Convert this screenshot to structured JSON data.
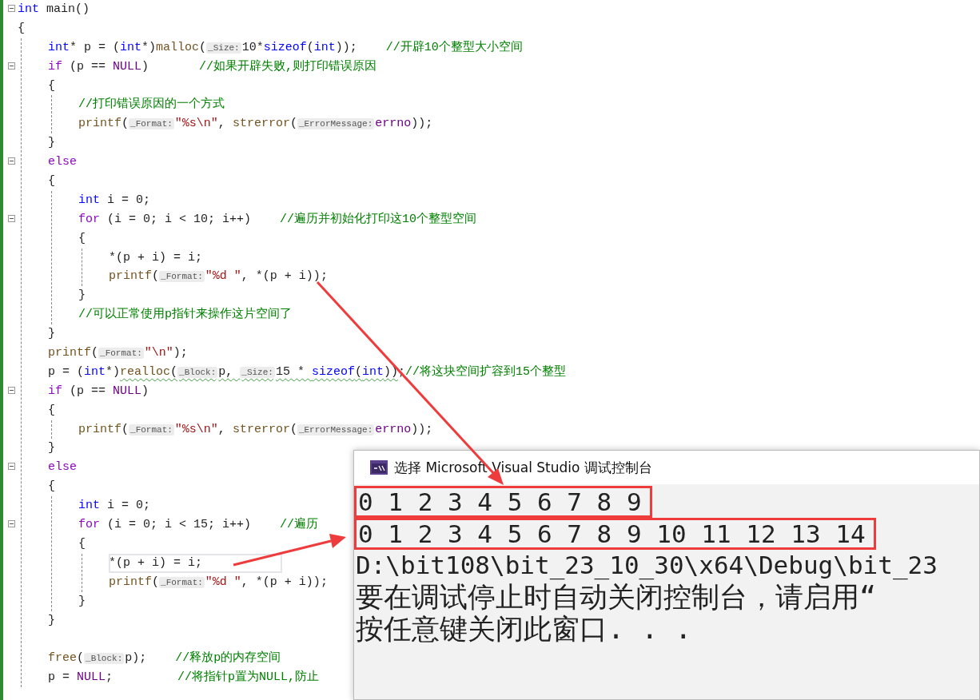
{
  "editor": {
    "lines": [
      {
        "expanded": true,
        "tokens": [
          {
            "kind": "type",
            "text": "int"
          },
          {
            "kind": "plain",
            "text": " main()"
          }
        ]
      },
      {
        "tokens": [
          {
            "kind": "plain",
            "text": "{"
          }
        ],
        "children": [
          {
            "tokens": [
              {
                "kind": "type",
                "text": "int"
              },
              {
                "kind": "plain",
                "text": "* p = ("
              },
              {
                "kind": "type",
                "text": "int"
              },
              {
                "kind": "plain",
                "text": "*)"
              },
              {
                "kind": "func",
                "text": "malloc"
              },
              {
                "kind": "plain",
                "text": "("
              },
              {
                "kind": "hint",
                "text": "_Size:"
              },
              {
                "kind": "plain",
                "text": "10*"
              },
              {
                "kind": "type",
                "text": "sizeof"
              },
              {
                "kind": "plain",
                "text": "("
              },
              {
                "kind": "type",
                "text": "int"
              },
              {
                "kind": "plain",
                "text": "));    "
              },
              {
                "kind": "comment",
                "text": "//开辟10个整型大小空间"
              }
            ]
          },
          {
            "expanded": true,
            "tokens": [
              {
                "kind": "control",
                "text": "if"
              },
              {
                "kind": "plain",
                "text": " (p == "
              },
              {
                "kind": "macro",
                "text": "NULL"
              },
              {
                "kind": "plain",
                "text": ")       "
              },
              {
                "kind": "comment",
                "text": "//如果开辟失败,则打印错误原因"
              }
            ]
          },
          {
            "tokens": [
              {
                "kind": "plain",
                "text": "{"
              }
            ],
            "children": [
              {
                "tokens": [
                  {
                    "kind": "comment",
                    "text": "//打印错误原因的一个方式"
                  }
                ]
              },
              {
                "tokens": [
                  {
                    "kind": "func",
                    "text": "printf"
                  },
                  {
                    "kind": "plain",
                    "text": "("
                  },
                  {
                    "kind": "hint",
                    "text": "_Format:"
                  },
                  {
                    "kind": "string",
                    "text": "\"%s\\n\""
                  },
                  {
                    "kind": "plain",
                    "text": ", "
                  },
                  {
                    "kind": "func",
                    "text": "strerror"
                  },
                  {
                    "kind": "plain",
                    "text": "("
                  },
                  {
                    "kind": "hint",
                    "text": "_ErrorMessage:"
                  },
                  {
                    "kind": "macro",
                    "text": "errno"
                  },
                  {
                    "kind": "plain",
                    "text": "));"
                  }
                ]
              }
            ]
          },
          {
            "tokens": [
              {
                "kind": "plain",
                "text": "}"
              }
            ]
          },
          {
            "expanded": true,
            "tokens": [
              {
                "kind": "control",
                "text": "else"
              }
            ]
          },
          {
            "tokens": [
              {
                "kind": "plain",
                "text": "{"
              }
            ],
            "children": [
              {
                "tokens": [
                  {
                    "kind": "type",
                    "text": "int"
                  },
                  {
                    "kind": "plain",
                    "text": " i = 0;"
                  }
                ]
              },
              {
                "expanded": true,
                "tokens": [
                  {
                    "kind": "control",
                    "text": "for"
                  },
                  {
                    "kind": "plain",
                    "text": " (i = 0; i < 10; i++)    "
                  },
                  {
                    "kind": "comment",
                    "text": "//遍历并初始化打印这10个整型空间"
                  }
                ]
              },
              {
                "tokens": [
                  {
                    "kind": "plain",
                    "text": "{"
                  }
                ],
                "children": [
                  {
                    "tokens": [
                      {
                        "kind": "plain",
                        "text": "*(p + i) = i;"
                      }
                    ]
                  },
                  {
                    "tokens": [
                      {
                        "kind": "func",
                        "text": "printf"
                      },
                      {
                        "kind": "plain",
                        "text": "("
                      },
                      {
                        "kind": "hint",
                        "text": "_Format:"
                      },
                      {
                        "kind": "string",
                        "text": "\"%d \""
                      },
                      {
                        "kind": "plain",
                        "text": ", *(p + i));"
                      }
                    ]
                  }
                ]
              },
              {
                "tokens": [
                  {
                    "kind": "plain",
                    "text": "}"
                  }
                ]
              },
              {
                "tokens": [
                  {
                    "kind": "comment",
                    "text": "//可以正常使用p指针来操作这片空间了"
                  }
                ]
              }
            ]
          },
          {
            "tokens": [
              {
                "kind": "plain",
                "text": "}"
              }
            ]
          },
          {
            "tokens": [
              {
                "kind": "func",
                "text": "printf"
              },
              {
                "kind": "plain",
                "text": "("
              },
              {
                "kind": "hint",
                "text": "_Format:"
              },
              {
                "kind": "string",
                "text": "\"\\n\""
              },
              {
                "kind": "plain",
                "text": ");"
              }
            ]
          },
          {
            "tokens": [
              {
                "kind": "plain",
                "text": "p = ("
              },
              {
                "kind": "type",
                "text": "int"
              },
              {
                "kind": "plain",
                "text": "*)"
              },
              {
                "kind": "group",
                "squiggle": true,
                "tokens": [
                  {
                    "kind": "func",
                    "text": "realloc"
                  },
                  {
                    "kind": "plain",
                    "text": "("
                  },
                  {
                    "kind": "hint",
                    "text": "_Block:"
                  },
                  {
                    "kind": "plain",
                    "text": "p, "
                  },
                  {
                    "kind": "hint",
                    "text": "_Size:"
                  },
                  {
                    "kind": "plain",
                    "text": "15 * "
                  },
                  {
                    "kind": "type",
                    "text": "sizeof"
                  },
                  {
                    "kind": "plain",
                    "text": "("
                  },
                  {
                    "kind": "type",
                    "text": "int"
                  },
                  {
                    "kind": "plain",
                    "text": "))"
                  }
                ]
              },
              {
                "kind": "plain",
                "text": ";"
              },
              {
                "kind": "comment",
                "text": "//将这块空间扩容到15个整型"
              }
            ]
          },
          {
            "expanded": true,
            "tokens": [
              {
                "kind": "control",
                "text": "if"
              },
              {
                "kind": "plain",
                "text": " (p == "
              },
              {
                "kind": "macro",
                "text": "NULL"
              },
              {
                "kind": "plain",
                "text": ")"
              }
            ]
          },
          {
            "tokens": [
              {
                "kind": "plain",
                "text": "{"
              }
            ],
            "children": [
              {
                "tokens": [
                  {
                    "kind": "func",
                    "text": "printf"
                  },
                  {
                    "kind": "plain",
                    "text": "("
                  },
                  {
                    "kind": "hint",
                    "text": "_Format:"
                  },
                  {
                    "kind": "string",
                    "text": "\"%s\\n\""
                  },
                  {
                    "kind": "plain",
                    "text": ", "
                  },
                  {
                    "kind": "func",
                    "text": "strerror"
                  },
                  {
                    "kind": "plain",
                    "text": "("
                  },
                  {
                    "kind": "hint",
                    "text": "_ErrorMessage:"
                  },
                  {
                    "kind": "macro",
                    "text": "errno"
                  },
                  {
                    "kind": "plain",
                    "text": "));"
                  }
                ]
              }
            ]
          },
          {
            "tokens": [
              {
                "kind": "plain",
                "text": "}"
              }
            ]
          },
          {
            "expanded": true,
            "tokens": [
              {
                "kind": "control",
                "text": "else"
              }
            ]
          },
          {
            "tokens": [
              {
                "kind": "plain",
                "text": "{"
              }
            ],
            "children": [
              {
                "tokens": [
                  {
                    "kind": "type",
                    "text": "int"
                  },
                  {
                    "kind": "plain",
                    "text": " i = 0;"
                  }
                ]
              },
              {
                "expanded": true,
                "tokens": [
                  {
                    "kind": "control",
                    "text": "for"
                  },
                  {
                    "kind": "plain",
                    "text": " (i = 0; i < 15; i++)    "
                  },
                  {
                    "kind": "comment",
                    "text": "//遍历"
                  }
                ]
              },
              {
                "tokens": [
                  {
                    "kind": "plain",
                    "text": "{"
                  }
                ],
                "children": [
                  {
                    "current": true,
                    "tokens": [
                      {
                        "kind": "plain",
                        "text": "*(p + i) = i;"
                      }
                    ]
                  },
                  {
                    "tokens": [
                      {
                        "kind": "func",
                        "text": "printf"
                      },
                      {
                        "kind": "plain",
                        "text": "("
                      },
                      {
                        "kind": "hint",
                        "text": "_Format:"
                      },
                      {
                        "kind": "string",
                        "text": "\"%d \""
                      },
                      {
                        "kind": "plain",
                        "text": ", *(p + i));"
                      }
                    ]
                  }
                ]
              },
              {
                "tokens": [
                  {
                    "kind": "plain",
                    "text": "}"
                  }
                ]
              }
            ]
          },
          {
            "tokens": [
              {
                "kind": "plain",
                "text": "}"
              }
            ]
          },
          {
            "gap_before": true,
            "tokens": [
              {
                "kind": "func",
                "text": "free"
              },
              {
                "kind": "plain",
                "text": "("
              },
              {
                "kind": "hint",
                "text": "_Block:"
              },
              {
                "kind": "plain",
                "text": "p);    "
              },
              {
                "kind": "comment",
                "text": "//释放p的内存空间"
              }
            ]
          },
          {
            "tokens": [
              {
                "kind": "plain",
                "text": "p = "
              },
              {
                "kind": "macro",
                "text": "NULL"
              },
              {
                "kind": "plain",
                "text": ";         "
              },
              {
                "kind": "comment",
                "text": "//将指针p置为NULL,防止"
              }
            ]
          }
        ]
      }
    ]
  },
  "console": {
    "title": "选择 Microsoft Visual Studio 调试控制台",
    "lines": [
      {
        "text": "0 1 2 3 4 5 6 7 8 9",
        "boxed": true
      },
      {
        "text": "0 1 2 3 4 5 6 7 8 9 10 11 12 13 14",
        "boxed": true
      },
      {
        "text": "D:\\bit108\\bit_23_10_30\\x64\\Debug\\bit_23",
        "boxed": false
      },
      {
        "text": "要在调试停止时自动关闭控制台，请启用“",
        "boxed": false
      },
      {
        "text": "按任意键关闭此窗口. . .",
        "boxed": false
      }
    ]
  }
}
